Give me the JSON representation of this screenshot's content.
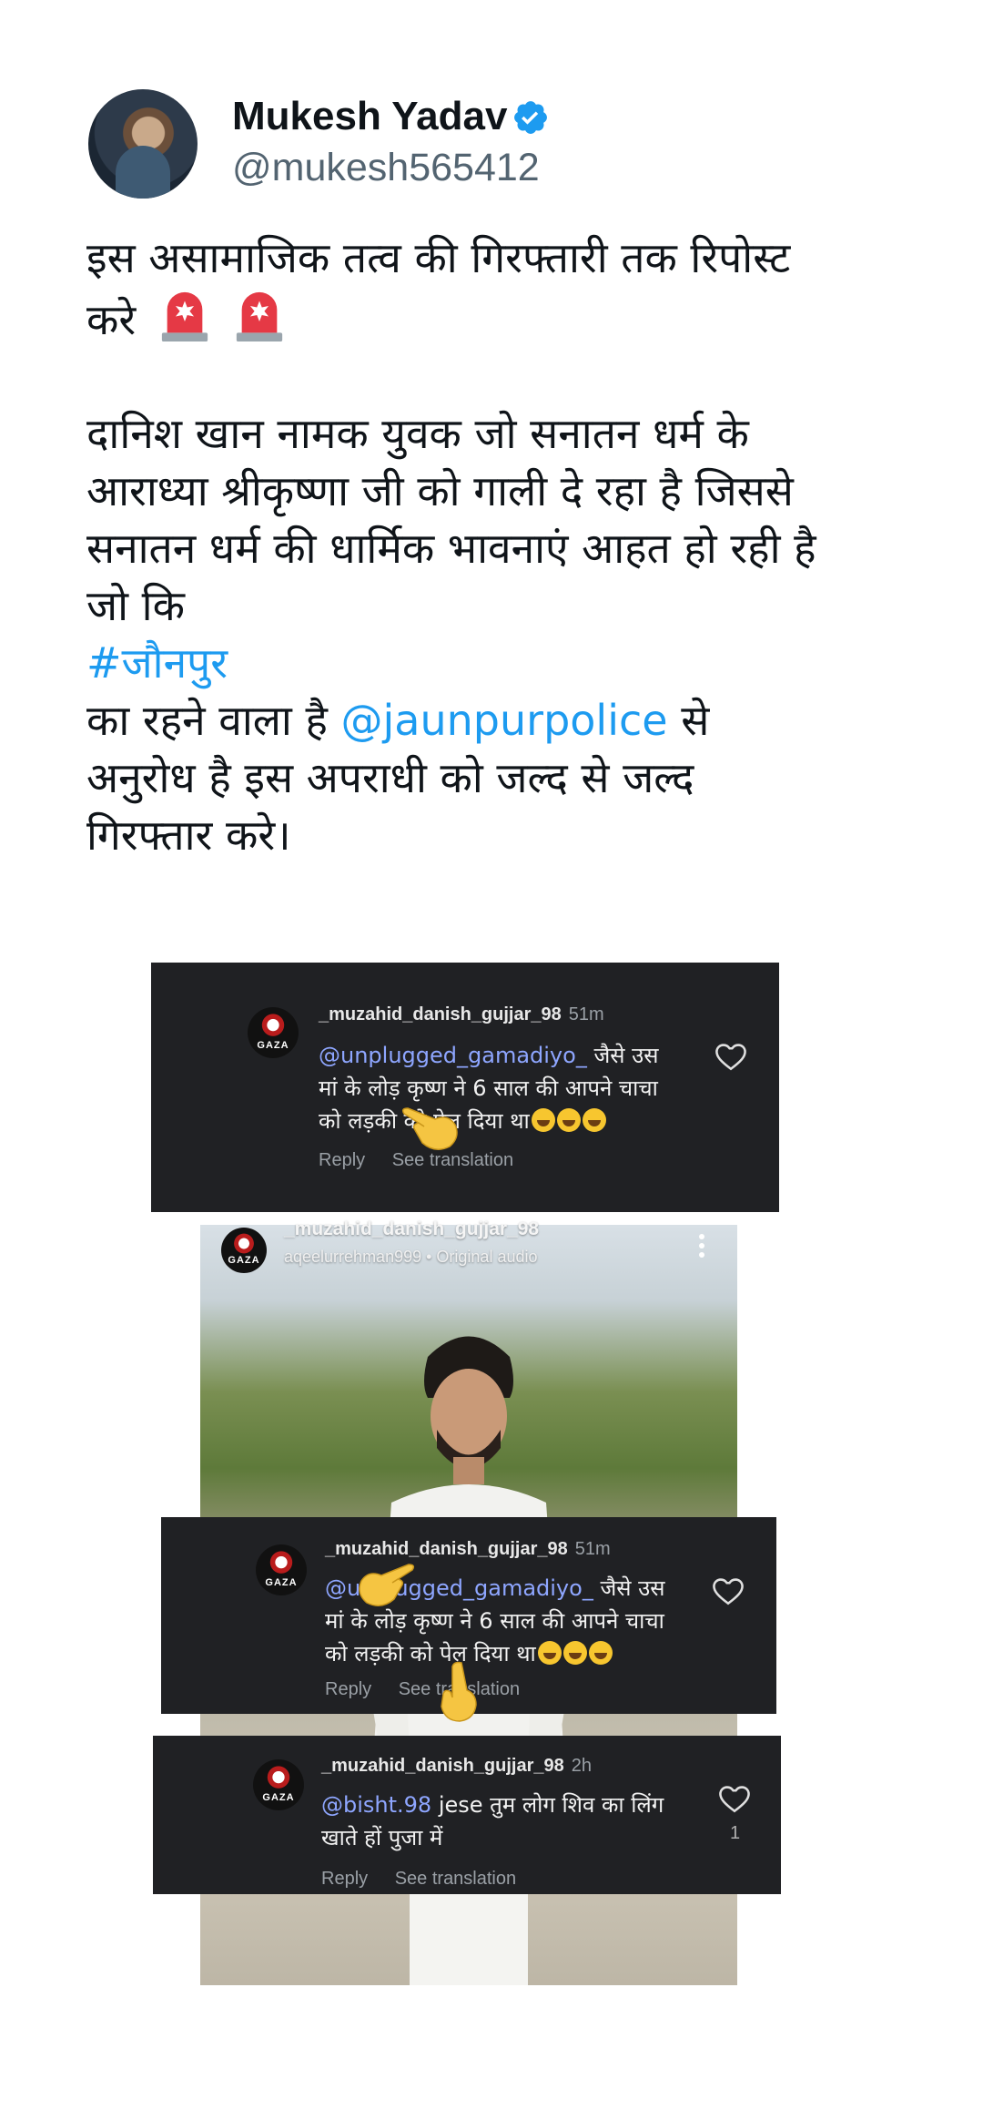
{
  "header": {
    "display_name": "Mukesh Yadav",
    "handle": "@mukesh565412",
    "verified_icon": "verified-badge-icon"
  },
  "tweet": {
    "lines": [
      "इस असामाजिक तत्व की गिरफ्तारी तक रिपोस्ट",
      "करे",
      "दानिश खान नामक युवक जो सनातन धर्म के",
      "आराध्या श्रीकृष्णा जी को गाली दे रहा है जिससे",
      "सनातन धर्म की धार्मिक भावनाएं आहत हो रही है",
      "जो कि"
    ],
    "hashtag": "#जौनपुर",
    "line_before_mention": "का रहने वाला है",
    "mention": "@jaunpurpolice",
    "line_after_mention": "से",
    "closing_lines": [
      "अनुरोध है इस अपराधी को जल्द से जल्द",
      "गिरफ्तार करे।"
    ],
    "emoji": "police-siren-icon"
  },
  "media": {
    "comment_top": {
      "username": "_muzahid_danish_gujjar_98",
      "time": "51m",
      "mention": "@unplugged_gamadiyo_",
      "text_after_mention": "जैसे उस",
      "line2": "मां के लोड़ कृष्ण ने 6 साल की आपने चाचा",
      "line3": "को लड़की को पेल दिया था",
      "reply": "Reply",
      "see_translation": "See translation",
      "avatar_text": "GAZA"
    },
    "reel": {
      "username": "_muzahid_danish_gujjar_98",
      "audio": "aqeelurrehman999 • Original audio"
    },
    "comment_middle": {
      "username": "_muzahid_danish_gujjar_98",
      "time": "51m",
      "mention": "@unplugged_gamadiyo_",
      "text_after_mention": "जैसे उस",
      "line2": "मां के लोड़ कृष्ण ने 6 साल की आपने चाचा",
      "line3": "को लड़की को पेल दिया था",
      "reply": "Reply",
      "see_translation": "See translation",
      "avatar_text": "GAZA"
    },
    "comment_bottom": {
      "username": "_muzahid_danish_gujjar_98",
      "time": "2h",
      "mention": "@bisht.98",
      "text_after_mention": "jese तुम लोग शिव का लिंग",
      "line2": "खाते हों पुजा में",
      "reply": "Reply",
      "see_translation": "See translation",
      "like_count": "1",
      "avatar_text": "GAZA"
    }
  },
  "colors": {
    "link": "#1d9bf0",
    "verified": "#1d9bf0",
    "card_bg": "#202124",
    "mention_dark": "#8ea6ff"
  }
}
